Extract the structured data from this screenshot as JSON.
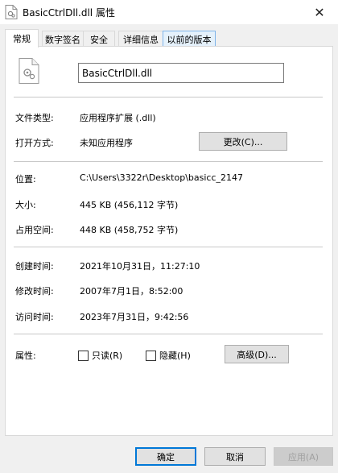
{
  "window": {
    "title": "BasicCtrlDll.dll 属性",
    "close_glyph": "✕",
    "icon": "file-icon"
  },
  "tabs": [
    {
      "label": "常规",
      "active": true
    },
    {
      "label": "数字签名",
      "active": false
    },
    {
      "label": "安全",
      "active": false
    },
    {
      "label": "详细信息",
      "active": false
    },
    {
      "label": "以前的版本",
      "active": false
    }
  ],
  "general": {
    "file_name": "BasicCtrlDll.dll",
    "file_type_label": "文件类型:",
    "file_type_value": "应用程序扩展 (.dll)",
    "opens_with_label": "打开方式:",
    "opens_with_value": "未知应用程序",
    "change_button": "更改(C)...",
    "location_label": "位置:",
    "location_value": "C:\\Users\\3322r\\Desktop\\basicc_2147",
    "size_label": "大小:",
    "size_value": "445 KB (456,112 字节)",
    "disk_size_label": "占用空间:",
    "disk_size_value": "448 KB (458,752 字节)",
    "created_label": "创建时间:",
    "created_value": "2021年10月31日，11:27:10",
    "modified_label": "修改时间:",
    "modified_value": "2007年7月1日，8:52:00",
    "accessed_label": "访问时间:",
    "accessed_value": "2023年7月31日，9:42:56",
    "attributes_label": "属性:",
    "readonly_label": "只读(R)",
    "hidden_label": "隐藏(H)",
    "advanced_button": "高级(D)..."
  },
  "footer": {
    "ok": "确定",
    "cancel": "取消",
    "apply": "应用(A)"
  }
}
